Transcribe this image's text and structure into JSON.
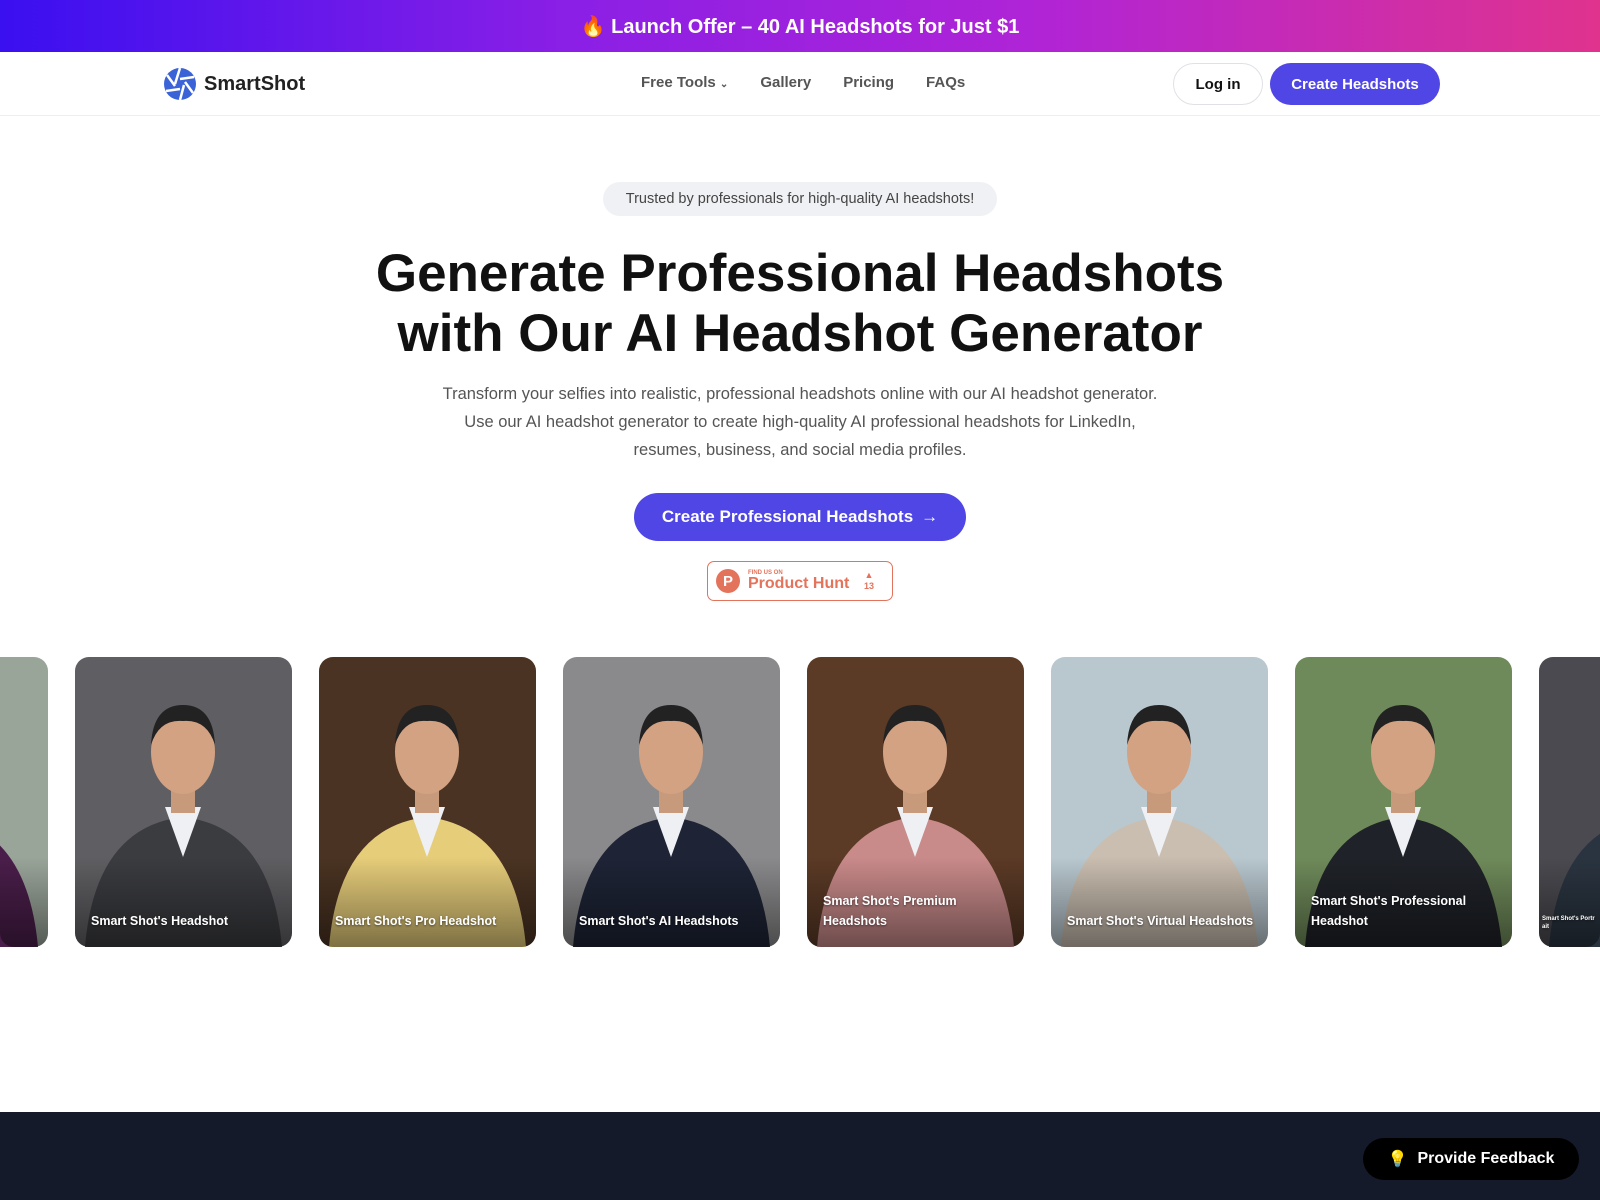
{
  "banner": {
    "icon": "fire-icon",
    "text": "🔥 Launch Offer – 40 AI Headshots for Just $1"
  },
  "nav": {
    "brand": "SmartShot",
    "items": [
      "Free Tools",
      "Gallery",
      "Pricing",
      "FAQs"
    ],
    "login": "Log in",
    "create": "Create Headshots"
  },
  "hero": {
    "badge": "Trusted by professionals for high-quality AI headshots!",
    "title_line1": "Generate Professional Headshots",
    "title_line2": "with Our AI Headshot Generator",
    "subtitle": "Transform your selfies into realistic, professional headshots online with our AI headshot generator. Use our AI headshot generator to create high-quality AI professional headshots for LinkedIn, resumes, business, and social media profiles.",
    "cta": "Create Professional Headshots",
    "product_hunt": {
      "small": "FIND US ON",
      "name": "Product Hunt",
      "votes": "13"
    }
  },
  "cards": [
    {
      "caption": "",
      "bg": "#9aa59a",
      "suit": "#4a1e4a"
    },
    {
      "caption": "Smart Shot's Headshot",
      "bg": "#5f5f63",
      "suit": "#3b3c40"
    },
    {
      "caption": "Smart Shot's Pro Headshot",
      "bg": "#4a3322",
      "suit": "#e6cd7a"
    },
    {
      "caption": "Smart Shot's AI Headshots",
      "bg": "#8a8a8c",
      "suit": "#1e2436"
    },
    {
      "caption": "Smart Shot's Premium Headshots",
      "bg": "#5b3a26",
      "suit": "#c98a8a"
    },
    {
      "caption": "Smart Shot's Virtual Headshots",
      "bg": "#b9c8cf",
      "suit": "#c9beb0"
    },
    {
      "caption": "Smart Shot's Professional Headshot",
      "bg": "#6f8a5a",
      "suit": "#1f2228"
    },
    {
      "caption": "Smart Shot's Portrait",
      "bg": "#4a4a50",
      "suit": "#2a3440"
    }
  ],
  "feedback": {
    "label": "Provide Feedback",
    "icon": "lightbulb-icon"
  },
  "colors": {
    "accent": "#4f46e5",
    "footer": "#141a2a",
    "product_hunt": "#e4735c"
  }
}
